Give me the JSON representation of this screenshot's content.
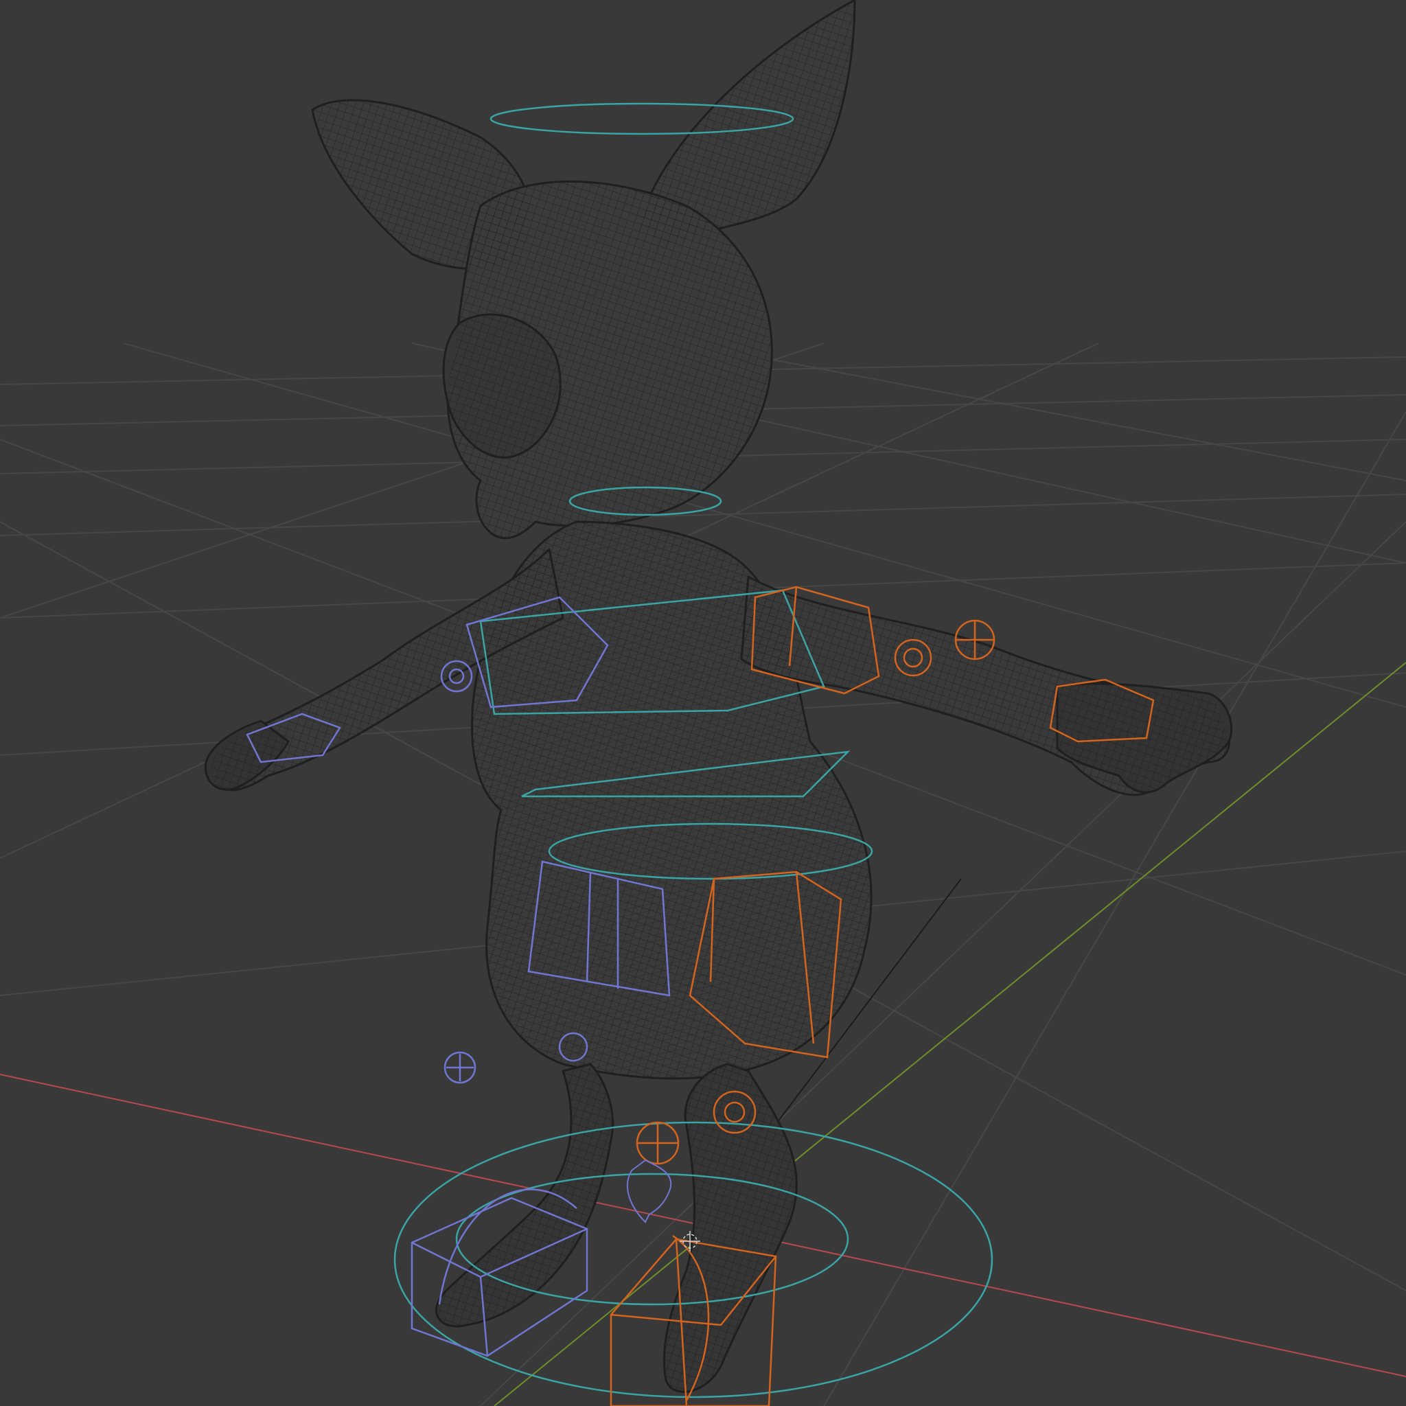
{
  "viewport": {
    "background": "#393939",
    "grid_color": "#474747",
    "axis_x_color": "#b8494f",
    "axis_y_color": "#6f8f2a",
    "mesh_color": "#1f1f1f",
    "mesh_fill": "#3a3a3a",
    "rig_cyan": "#3ba5a5",
    "rig_blue": "#7176d2",
    "rig_orange": "#d4641e",
    "cursor_color": "#d0d0d0"
  }
}
